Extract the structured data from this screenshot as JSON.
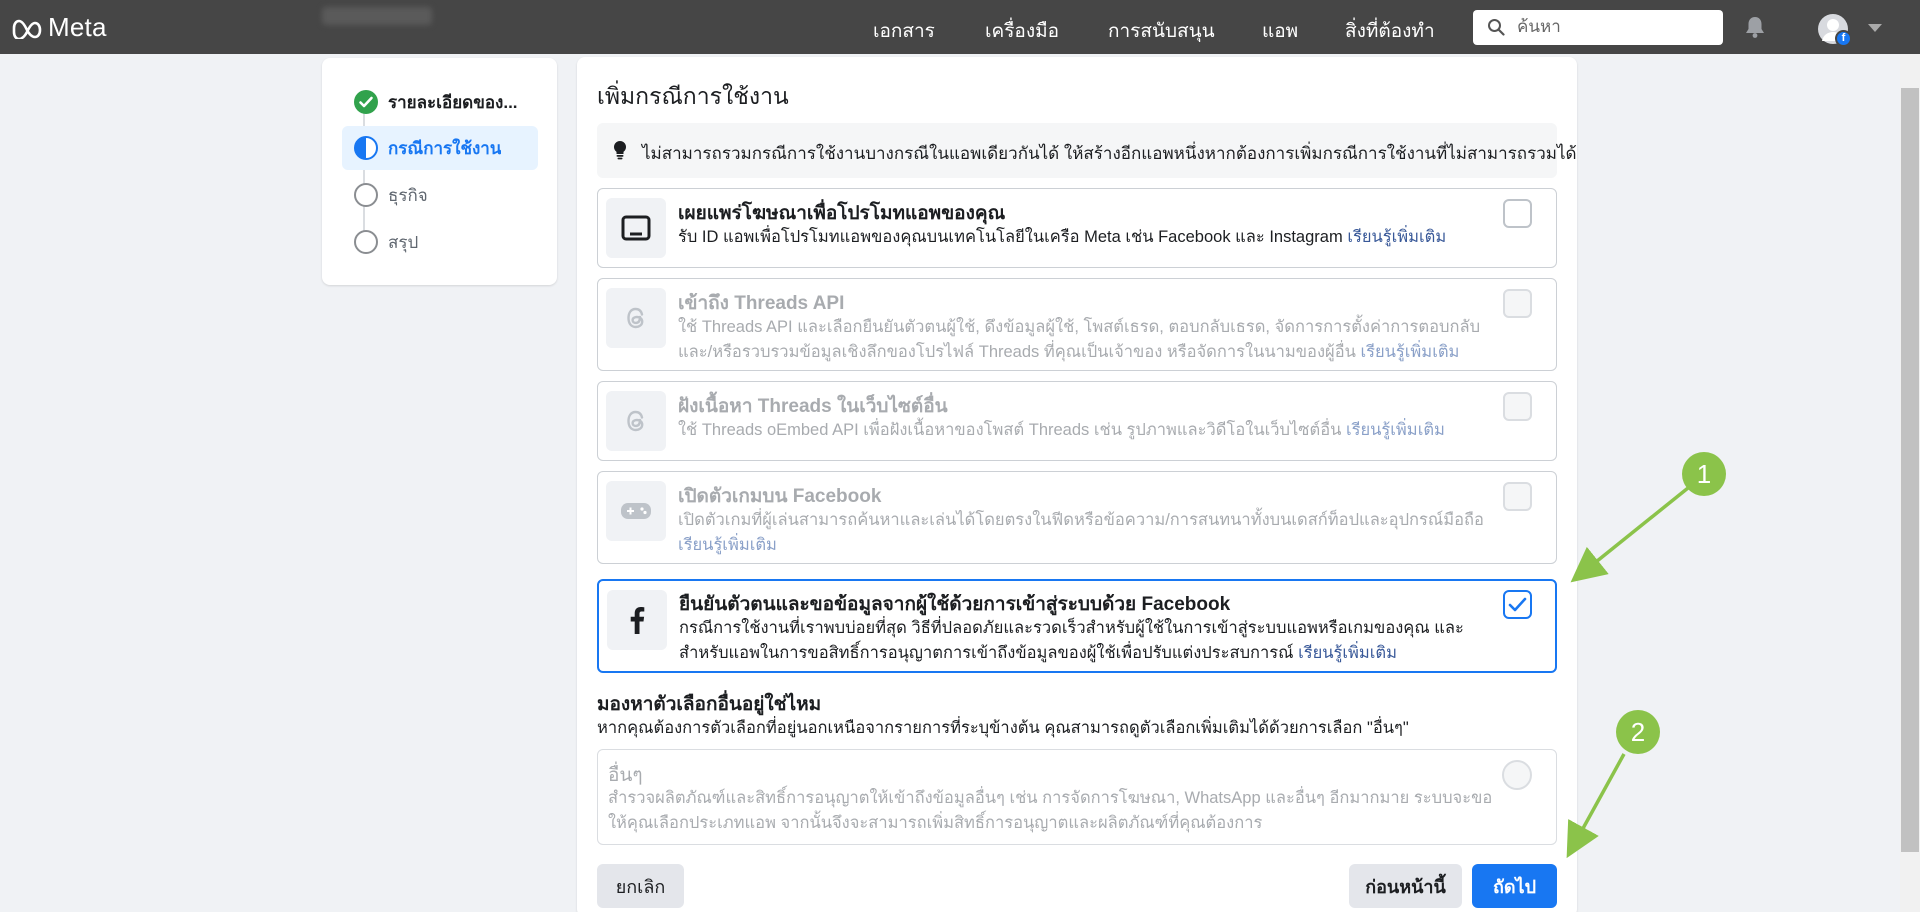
{
  "topbar": {
    "brand": "Meta",
    "nav": [
      {
        "label": "เอกสาร"
      },
      {
        "label": "เครื่องมือ"
      },
      {
        "label": "การสนับสนุน"
      },
      {
        "label": "แอพ"
      },
      {
        "label": "สิ่งที่ต้องทำ"
      }
    ],
    "search_placeholder": "ค้นหา",
    "icons": {
      "search": "search-icon",
      "bell": "bell-icon",
      "avatar": "avatar"
    }
  },
  "steps": [
    {
      "label": "รายละเอียดของ...",
      "state": "done"
    },
    {
      "label": "กรณีการใช้งาน",
      "state": "current"
    },
    {
      "label": "ธุรกิจ",
      "state": "todo"
    },
    {
      "label": "สรุป",
      "state": "todo"
    }
  ],
  "main": {
    "title": "เพิ่มกรณีการใช้งาน",
    "info": "ไม่สามารถรวมกรณีการใช้งานบางกรณีในแอพเดียวกันได้ ให้สร้างอีกแอพหนึ่งหากต้องการเพิ่มกรณีการใช้งานที่ไม่สามารถรวมได้",
    "use_cases": [
      {
        "title": "เผยแพร่โฆษณาเพื่อโปรโมทแอพของคุณ",
        "desc": "รับ ID แอพเพื่อโปรโมทแอพของคุณบนเทคโนโลยีในเครือ Meta เช่น Facebook และ Instagram",
        "link": "เรียนรู้เพิ่มเติม",
        "icon": "tablet-icon",
        "disabled": false,
        "checked": false
      },
      {
        "title": "เข้าถึง Threads API",
        "desc": "ใช้ Threads API และเลือกยืนยันตัวตนผู้ใช้, ดึงข้อมูลผู้ใช้, โพสต์เธรด, ตอบกลับเธรด, จัดการการตั้งค่าการตอบกลับ และ/หรือรวบรวมข้อมูลเชิงลึกของโปรไฟล์ Threads ที่คุณเป็นเจ้าของ หรือจัดการในนามของผู้อื่น",
        "link": "เรียนรู้เพิ่มเติม",
        "icon": "threads-icon",
        "disabled": true,
        "checked": false
      },
      {
        "title": "ฝังเนื้อหา Threads ในเว็บไซต์อื่น",
        "desc": "ใช้ Threads oEmbed API เพื่อฝังเนื้อหาของโพสต์ Threads เช่น รูปภาพและวิดีโอในเว็บไซต์อื่น",
        "link": "เรียนรู้เพิ่มเติม",
        "icon": "threads-icon",
        "disabled": true,
        "checked": false
      },
      {
        "title": "เปิดตัวเกมบน Facebook",
        "desc": "เปิดตัวเกมที่ผู้เล่นสามารถค้นหาและเล่นได้โดยตรงในฟีดหรือข้อความ/การสนทนาทั้งบนเดสก์ท็อปและอุปกรณ์มือถือ",
        "link": "เรียนรู้เพิ่มเติม",
        "icon": "gamepad-icon",
        "disabled": true,
        "checked": false
      },
      {
        "title": "ยืนยันตัวตนและขอข้อมูลจากผู้ใช้ด้วยการเข้าสู่ระบบด้วย Facebook",
        "desc": "กรณีการใช้งานที่เราพบบ่อยที่สุด วิธีที่ปลอดภัยและรวดเร็วสำหรับผู้ใช้ในการเข้าสู่ระบบแอพหรือเกมของคุณ และสำหรับแอพในการขอสิทธิ์การอนุญาตการเข้าถึงข้อมูลของผู้ใช้เพื่อปรับแต่งประสบการณ์",
        "link": "เรียนรู้เพิ่มเติม",
        "icon": "facebook-icon",
        "disabled": false,
        "checked": true
      }
    ],
    "more": {
      "title": "มองหาตัวเลือกอื่นอยู่ใช่ไหม",
      "desc": "หากคุณต้องการตัวเลือกที่อยู่นอกเหนือจากรายการที่ระบุข้างต้น คุณสามารถดูตัวเลือกเพิ่มเติมได้ด้วยการเลือก \"อื่นๆ\""
    },
    "other": {
      "title": "อื่นๆ",
      "desc": "สำรวจผลิตภัณฑ์และสิทธิ์การอนุญาตให้เข้าถึงข้อมูลอื่นๆ เช่น การจัดการโฆษณา, WhatsApp และอื่นๆ อีกมากมาย ระบบจะขอให้คุณเลือกประเภทแอพ จากนั้นจึงจะสามารถเพิ่มสิทธิ์การอนุญาตและผลิตภัณฑ์ที่คุณต้องการ"
    },
    "buttons": {
      "cancel": "ยกเลิก",
      "back": "ก่อนหน้านี้",
      "next": "ถัดไป"
    }
  },
  "annotations": [
    {
      "number": "1",
      "color": "#8bc34a"
    },
    {
      "number": "2",
      "color": "#8bc34a"
    }
  ],
  "colors": {
    "topbar": "#464646",
    "accent": "#1877f2",
    "link": "#385898",
    "success": "#31a24c",
    "annotation": "#8bc34a"
  }
}
